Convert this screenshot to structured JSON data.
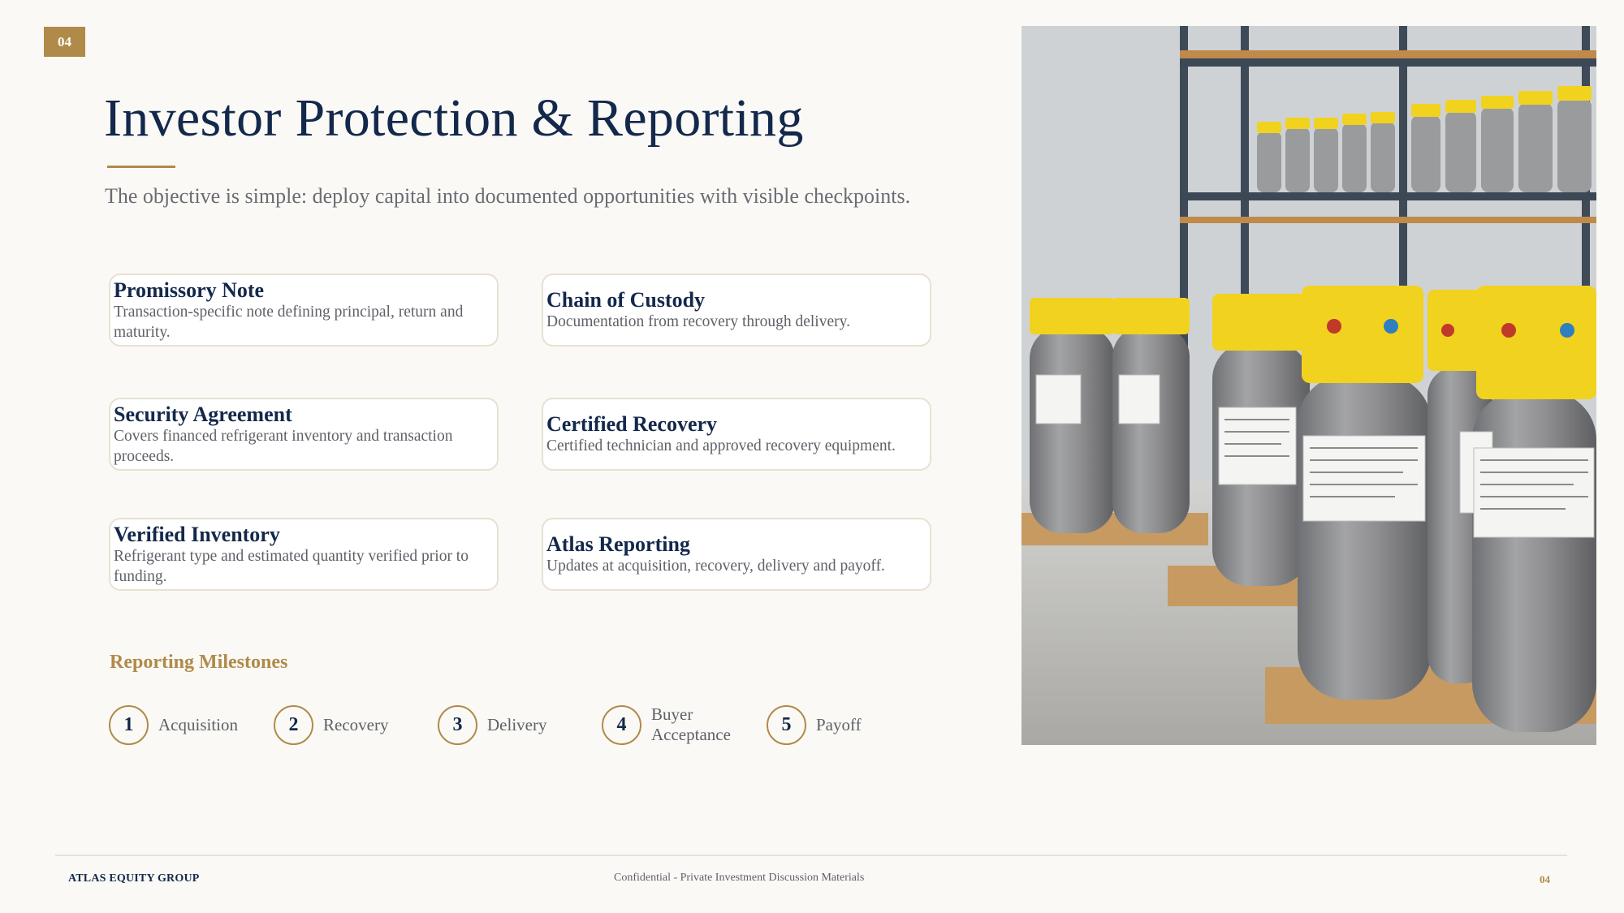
{
  "page_number": "04",
  "title": "Investor Protection & Reporting",
  "subtitle": "The objective is simple: deploy capital into documented opportunities with visible checkpoints.",
  "cards": [
    {
      "title": "Promissory Note",
      "desc": "Transaction-specific note defining principal, return and maturity."
    },
    {
      "title": "Chain of Custody",
      "desc": "Documentation from recovery through delivery."
    },
    {
      "title": "Security Agreement",
      "desc": "Covers financed refrigerant inventory and transaction proceeds."
    },
    {
      "title": "Certified Recovery",
      "desc": "Certified technician and approved recovery equipment."
    },
    {
      "title": "Verified Inventory",
      "desc": "Refrigerant type and estimated quantity verified prior to funding."
    },
    {
      "title": "Atlas Reporting",
      "desc": "Updates at acquisition, recovery, delivery and payoff."
    }
  ],
  "milestones": {
    "heading": "Reporting Milestones",
    "items": [
      {
        "number": "1",
        "label": "Acquisition"
      },
      {
        "number": "2",
        "label": "Recovery"
      },
      {
        "number": "3",
        "label": "Delivery"
      },
      {
        "number": "4",
        "label": "Buyer Acceptance"
      },
      {
        "number": "5",
        "label": "Payoff"
      }
    ]
  },
  "footer": {
    "left": "ATLAS EQUITY GROUP",
    "center": "Confidential - Private Investment Discussion Materials",
    "right": "04"
  },
  "colors": {
    "navy": "#13284b",
    "gold": "#b08a48",
    "cylinder_yellow": "#f1d21e",
    "cylinder_gray": "#8e8e90"
  }
}
